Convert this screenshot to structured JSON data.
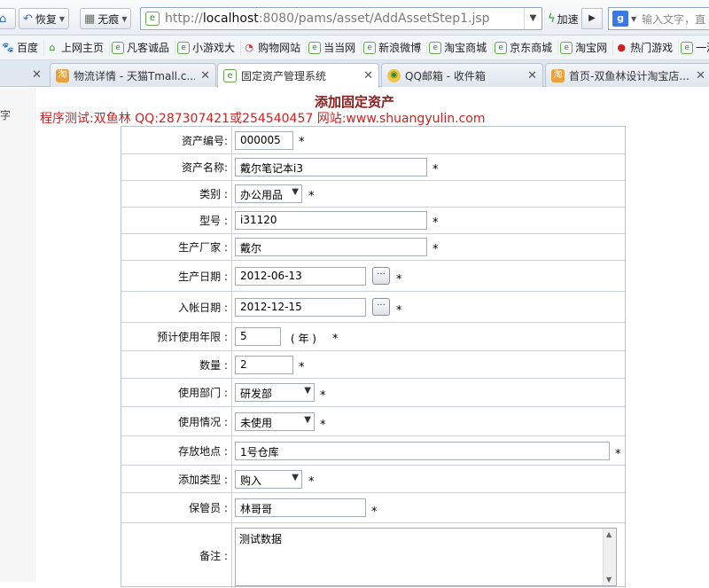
{
  "browser": {
    "back_label": "",
    "restore_label": "恢复",
    "incognito_label": "无痕",
    "url_gray_prefix": "http://",
    "url_host": "localhost",
    "url_rest": ":8080/pams/asset/AddAssetStep1.jsp",
    "speed_label": "加速",
    "search_placeholder": "输入文字，直"
  },
  "favorites": [
    {
      "icon": "paw-icon",
      "label": "百度"
    },
    {
      "icon": "home-icon",
      "label": "上网主页"
    },
    {
      "icon": "page-icon",
      "label": "凡客诚品"
    },
    {
      "icon": "page-icon",
      "label": "小游戏大"
    },
    {
      "icon": "cart-icon",
      "label": "购物网站"
    },
    {
      "icon": "page-icon",
      "label": "当当网"
    },
    {
      "icon": "page-icon",
      "label": "新浪微博"
    },
    {
      "icon": "page-icon",
      "label": "淘宝商城"
    },
    {
      "icon": "page-icon",
      "label": "京东商城"
    },
    {
      "icon": "page-icon",
      "label": "淘宝网"
    },
    {
      "icon": "fire-icon",
      "label": "热门游戏"
    },
    {
      "icon": "page-icon",
      "label": "一淘"
    }
  ],
  "tabs": [
    {
      "title": "物流详情 - 天猫Tmall.c...",
      "icon": "tmall-icon",
      "active": false
    },
    {
      "title": "固定资产管理系统",
      "icon": "page-icon",
      "active": true
    },
    {
      "title": "QQ邮箱 - 收件箱",
      "icon": "qq-icon",
      "active": false
    },
    {
      "title": "首页-双鱼林设计淘宝店...",
      "icon": "taobao-icon",
      "active": false
    }
  ],
  "side_text": "字",
  "page": {
    "title": "添加固定资产",
    "info": "程序测试:双鱼林 QQ:287307421或254540457 网站:www.shuangyulin.com"
  },
  "form": {
    "asset_no": {
      "label": "资产编号:",
      "value": "000005"
    },
    "asset_name": {
      "label": "资产名称:",
      "value": "戴尔笔记本i3"
    },
    "category": {
      "label": "类别 :",
      "value": "办公用品"
    },
    "model": {
      "label": "型号 :",
      "value": "i31120"
    },
    "manufacturer": {
      "label": "生产厂家 :",
      "value": "戴尔"
    },
    "production_date": {
      "label": "生产日期 :",
      "value": "2012-06-13"
    },
    "account_date": {
      "label": "入帐日期 :",
      "value": "2012-12-15"
    },
    "service_years": {
      "label": "预计使用年限 :",
      "value": "5",
      "unit": "( 年 )"
    },
    "quantity": {
      "label": "数量 :",
      "value": "2"
    },
    "department": {
      "label": "使用部门 :",
      "value": "研发部"
    },
    "usage_status": {
      "label": "使用情况 :",
      "value": "未使用"
    },
    "location": {
      "label": "存放地点 :",
      "value": "1号仓库"
    },
    "add_type": {
      "label": "添加类型 :",
      "value": "购入"
    },
    "custodian": {
      "label": "保管员 :",
      "value": "林哥哥"
    },
    "remark": {
      "label": "备注 :",
      "value": "测试数据"
    },
    "required_mark": "*",
    "calendar_glyph": "···"
  }
}
